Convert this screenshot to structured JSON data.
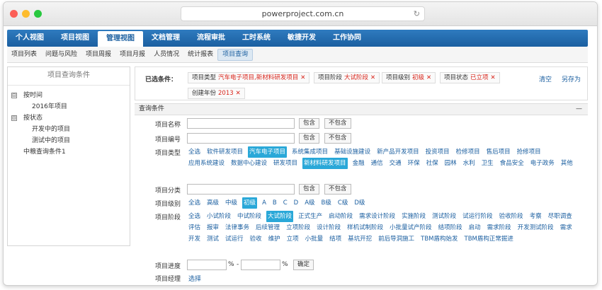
{
  "browser": {
    "url": "powerproject.com.cn"
  },
  "topnav": [
    "个人视图",
    "项目视图",
    "管理视图",
    "文档管理",
    "流程审批",
    "工时系统",
    "敏捷开发",
    "工作协同"
  ],
  "topnav_active": 2,
  "subnav": [
    "项目列表",
    "问题与风险",
    "项目周报",
    "项目月报",
    "人员情况",
    "统计报表",
    "项目查询"
  ],
  "subnav_active": 6,
  "left": {
    "title": "项目查询条件",
    "tree": [
      {
        "label": "按时间",
        "level": 0,
        "toggle": "⊟"
      },
      {
        "label": "2016年项目",
        "level": 1
      },
      {
        "label": "按状态",
        "level": 0,
        "toggle": "⊟"
      },
      {
        "label": "开发中的项目",
        "level": 1
      },
      {
        "label": "测试中的项目",
        "level": 1
      },
      {
        "label": "中粮查询条件1",
        "level": 0
      }
    ]
  },
  "selected": {
    "label": "已选条件：",
    "chips": [
      {
        "k": "项目类型",
        "v": "汽车电子项目,新材料研发项目"
      },
      {
        "k": "项目阶段",
        "v": "大试阶段"
      },
      {
        "k": "项目级别",
        "v": "初级"
      },
      {
        "k": "项目状态",
        "v": "已立项"
      },
      {
        "k": "创建年份",
        "v": "2013"
      }
    ],
    "clear": "清空",
    "save_as": "另存为"
  },
  "query": {
    "header": "查询条件",
    "collapse": "—",
    "name_label": "项目名称",
    "code_label": "项目编号",
    "contains": "包含",
    "not_contains": "不包含",
    "type_label": "项目类型",
    "type_options": [
      "全选",
      "软件研发项目",
      "汽车电子项目",
      "系统集成项目",
      "基础设施建设",
      "新产品开发项目",
      "投资项目",
      "检修项目",
      "售后项目",
      "抢修项目",
      "应用系统建设",
      "数据中心建设",
      "研发项目",
      "新材料研发项目",
      "金融",
      "通信",
      "交通",
      "环保",
      "社保",
      "园林",
      "水利",
      "卫生",
      "食品安全",
      "电子政务",
      "其他"
    ],
    "type_selected": [
      "汽车电子项目",
      "新材料研发项目"
    ],
    "category_label": "项目分类",
    "level_label": "项目级别",
    "level_options": [
      "全选",
      "高级",
      "中级",
      "初级",
      "A",
      "B",
      "C",
      "D",
      "A级",
      "B级",
      "C级",
      "D级"
    ],
    "level_selected": [
      "初级"
    ],
    "stage_label": "项目阶段",
    "stage_options": [
      "全选",
      "小试阶段",
      "中试阶段",
      "大试阶段",
      "正式生产",
      "启动阶段",
      "需求设计阶段",
      "实施阶段",
      "测试阶段",
      "试运行阶段",
      "验收阶段",
      "考察",
      "尽职调查",
      "评估",
      "报审",
      "法律事务",
      "后续管理",
      "立项阶段",
      "设计阶段",
      "样机试制阶段",
      "小批量试产阶段",
      "结项阶段",
      "启动",
      "需求阶段",
      "开发测试阶段",
      "需求",
      "开发",
      "测试",
      "试运行",
      "验收",
      "维护",
      "立项",
      "小批量",
      "结项",
      "基坑开挖",
      "前后导洞施工",
      "TBM盾构始发",
      "TBM盾构正常掘进"
    ],
    "stage_selected": [
      "大试阶段"
    ],
    "progress_label": "项目进度",
    "percent": "%",
    "dash": "-",
    "confirm": "确定",
    "manager_label": "项目经理",
    "select": "选择"
  }
}
